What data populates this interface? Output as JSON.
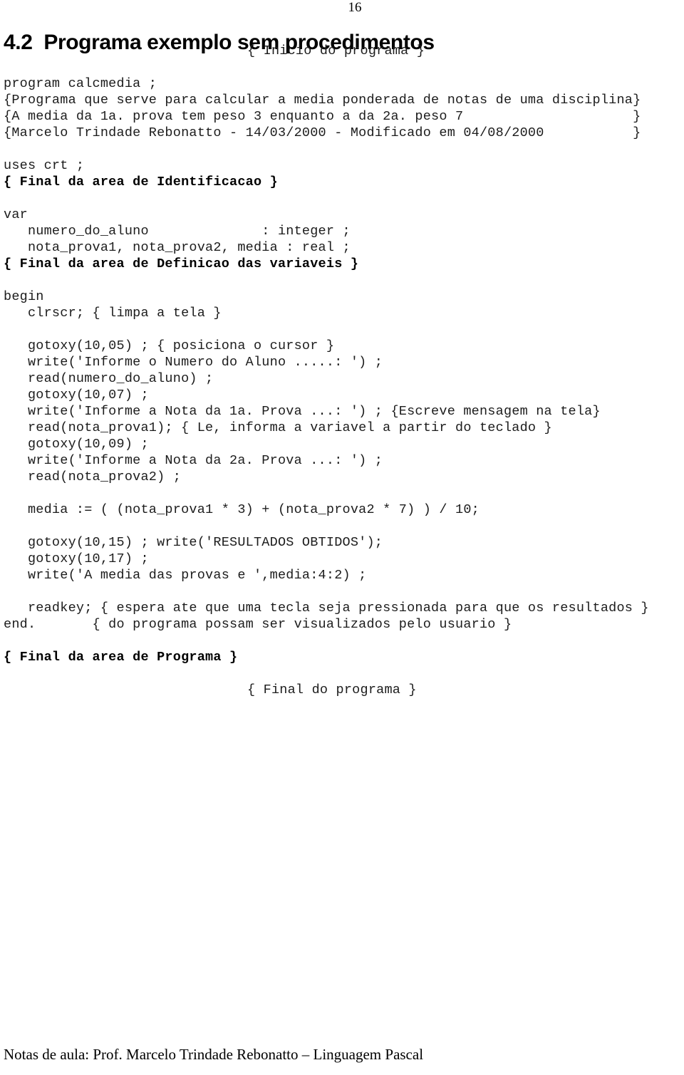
{
  "document": {
    "page_number": "16",
    "heading": "4.2  Programa exemplo sem procedimentos",
    "footer": "Notas de aula: Prof. Marcelo Trindade Rebonatto – Linguagem Pascal"
  },
  "code": {
    "lines": [
      {
        "id": "l01",
        "text": "{ Inicio do programa }",
        "style": "centered"
      },
      {
        "id": "l02",
        "text": "",
        "style": "blank"
      },
      {
        "id": "l03",
        "text": "program calcmedia ;",
        "style": "normal"
      },
      {
        "id": "l04",
        "text": "{Programa que serve para calcular a media ponderada de notas de uma disciplina}",
        "style": "normal"
      },
      {
        "id": "l05",
        "text": "{A media da 1a. prova tem peso 3 enquanto a da 2a. peso 7                     }",
        "style": "normal"
      },
      {
        "id": "l06",
        "text": "{Marcelo Trindade Rebonatto - 14/03/2000 - Modificado em 04/08/2000           }",
        "style": "normal"
      },
      {
        "id": "l07",
        "text": "",
        "style": "blank"
      },
      {
        "id": "l08",
        "text": "uses crt ;",
        "style": "normal"
      },
      {
        "id": "l09",
        "text": "{ Final da area de Identificacao }",
        "style": "bold"
      },
      {
        "id": "l10",
        "text": "",
        "style": "blank"
      },
      {
        "id": "l11",
        "text": "var",
        "style": "normal"
      },
      {
        "id": "l12",
        "text": "   numero_do_aluno              : integer ;",
        "style": "normal"
      },
      {
        "id": "l13",
        "text": "   nota_prova1, nota_prova2, media : real ;",
        "style": "normal"
      },
      {
        "id": "l14",
        "text": "{ Final da area de Definicao das variaveis }",
        "style": "bold"
      },
      {
        "id": "l15",
        "text": "",
        "style": "blank"
      },
      {
        "id": "l16",
        "text": "begin",
        "style": "normal"
      },
      {
        "id": "l17",
        "text": "   clrscr; { limpa a tela }",
        "style": "normal"
      },
      {
        "id": "l18",
        "text": "",
        "style": "blank"
      },
      {
        "id": "l19",
        "text": "   gotoxy(10,05) ; { posiciona o cursor }",
        "style": "normal"
      },
      {
        "id": "l20",
        "text": "   write('Informe o Numero do Aluno .....: ') ;",
        "style": "normal"
      },
      {
        "id": "l21",
        "text": "   read(numero_do_aluno) ;",
        "style": "normal"
      },
      {
        "id": "l22",
        "text": "   gotoxy(10,07) ;",
        "style": "normal"
      },
      {
        "id": "l23",
        "text": "   write('Informe a Nota da 1a. Prova ...: ') ; {Escreve mensagem na tela}",
        "style": "normal"
      },
      {
        "id": "l24",
        "text": "   read(nota_prova1); { Le, informa a variavel a partir do teclado }",
        "style": "normal"
      },
      {
        "id": "l25",
        "text": "   gotoxy(10,09) ;",
        "style": "normal"
      },
      {
        "id": "l26",
        "text": "   write('Informe a Nota da 2a. Prova ...: ') ;",
        "style": "normal"
      },
      {
        "id": "l27",
        "text": "   read(nota_prova2) ;",
        "style": "normal"
      },
      {
        "id": "l28",
        "text": "",
        "style": "blank"
      },
      {
        "id": "l29",
        "text": "   media := ( (nota_prova1 * 3) + (nota_prova2 * 7) ) / 10;",
        "style": "normal"
      },
      {
        "id": "l30",
        "text": "",
        "style": "blank"
      },
      {
        "id": "l31",
        "text": "   gotoxy(10,15) ; write('RESULTADOS OBTIDOS');",
        "style": "normal"
      },
      {
        "id": "l32",
        "text": "   gotoxy(10,17) ;",
        "style": "normal"
      },
      {
        "id": "l33",
        "text": "   write('A media das provas e ',media:4:2) ;",
        "style": "normal"
      },
      {
        "id": "l34",
        "text": "",
        "style": "blank"
      },
      {
        "id": "l35",
        "text": "   readkey; { espera ate que uma tecla seja pressionada para que os resultados }",
        "style": "normal"
      },
      {
        "id": "l36",
        "text": "end.       { do programa possam ser visualizados pelo usuario }",
        "style": "normal"
      },
      {
        "id": "l37",
        "text": "",
        "style": "blank"
      },
      {
        "id": "l38",
        "text": "{ Final da area de Programa }",
        "style": "bold"
      },
      {
        "id": "l39",
        "text": "",
        "style": "blank"
      },
      {
        "id": "l40",
        "text": "{ Final do programa }",
        "style": "centered"
      }
    ]
  }
}
